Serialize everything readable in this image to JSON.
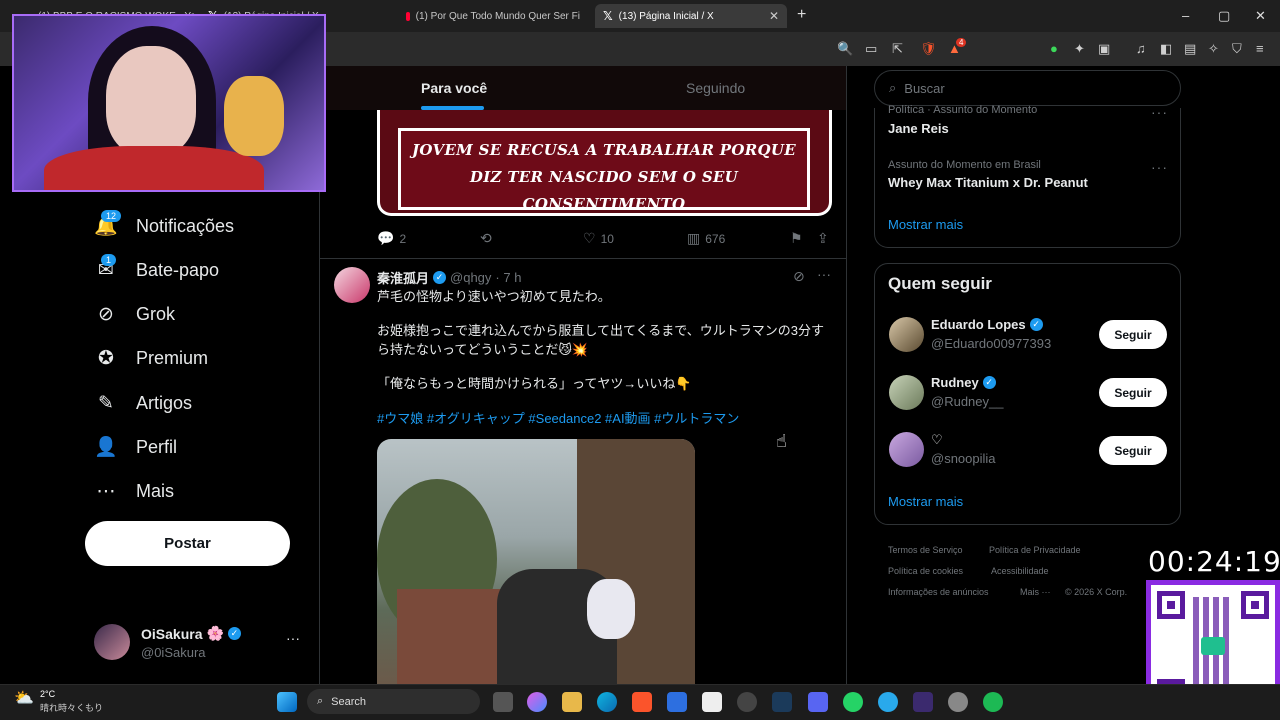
{
  "browser": {
    "tabs": [
      {
        "label": "(1) BBB E O RACISMO WOKE - YouTu"
      },
      {
        "label": "(13) Página Inicial / X"
      },
      {
        "label": "(1) Por Que Todo Mundo Quer Ser Fi"
      },
      {
        "label": "(13) Página Inicial / X"
      }
    ],
    "new_tab": "+",
    "window_controls": {
      "minimize": "–",
      "maximize": "▢",
      "close": "✕"
    },
    "ext_badge": "4"
  },
  "sidebar": {
    "items": [
      {
        "label": "Notificações",
        "icon": "bell-icon",
        "glyph": "🔔",
        "badge": "12"
      },
      {
        "label": "Bate-papo",
        "icon": "mail-icon",
        "glyph": "✉",
        "badge": "1"
      },
      {
        "label": "Grok",
        "icon": "grok-icon",
        "glyph": "⊘"
      },
      {
        "label": "Premium",
        "icon": "premium-icon",
        "glyph": "✪"
      },
      {
        "label": "Artigos",
        "icon": "article-icon",
        "glyph": "✎"
      },
      {
        "label": "Perfil",
        "icon": "person-icon",
        "glyph": "👤"
      },
      {
        "label": "Mais",
        "icon": "more-icon",
        "glyph": "⋯"
      }
    ],
    "post_button": "Postar",
    "profile": {
      "name": "OiSakura",
      "emoji": "🌸",
      "handle": "@0iSakura",
      "more": "···"
    }
  },
  "feed": {
    "tabs": [
      {
        "label": "Para você",
        "active": true
      },
      {
        "label": "Seguindo",
        "active": false
      }
    ],
    "meme_tweet": {
      "image_text": "JOVEM SE RECUSA A TRABALHAR PORQUE DIZ TER NASCIDO SEM O SEU CONSENTIMENTO",
      "replies": "2",
      "likes": "10",
      "views": "676"
    },
    "tweet": {
      "author": "秦淮孤月",
      "handle": "@qhgy",
      "time": "· 7 h",
      "lines": [
        "芦毛の怪物より速いやつ初めて見たわ。",
        "お姫様抱っこで連れ込んでから服直して出てくるまで、ウルトラマンの3分すら持たないってどういうことだ😼💥",
        "「俺ならもっと時間かけられる」ってヤツ→いいね👇"
      ],
      "hashtags": "#ウマ娘 #オグリキャップ #Seedance2 #AI動画 #ウルトラマン"
    }
  },
  "right": {
    "search_placeholder": "Buscar",
    "trends": [
      {
        "meta": "Política · Assunto do Momento",
        "name": "Jane Reis"
      },
      {
        "meta": "Assunto do Momento em Brasil",
        "name": "Whey Max Titanium x Dr. Peanut"
      }
    ],
    "show_more": "Mostrar mais",
    "who_to_follow": {
      "title": "Quem seguir",
      "people": [
        {
          "name": "Eduardo Lopes",
          "handle": "@Eduardo00977393",
          "verified": true,
          "button": "Seguir"
        },
        {
          "name": "Rudney",
          "handle": "@Rudney__",
          "verified": true,
          "button": "Seguir"
        },
        {
          "name": "♡",
          "handle": "@snoopilia",
          "verified": false,
          "button": "Seguir"
        }
      ],
      "show_more": "Mostrar mais"
    },
    "footer": [
      "Termos de Serviço",
      "Política de Privacidade",
      "Política de cookies",
      "Acessibilidade",
      "Informações de anúncios",
      "Mais ···",
      "© 2026 X Corp."
    ]
  },
  "overlay": {
    "timer": "00:24:19"
  },
  "taskbar": {
    "weather_temp": "2°C",
    "weather_desc": "晴れ時々くもり",
    "search_label": "Search",
    "accent": "#1d9bf0"
  }
}
